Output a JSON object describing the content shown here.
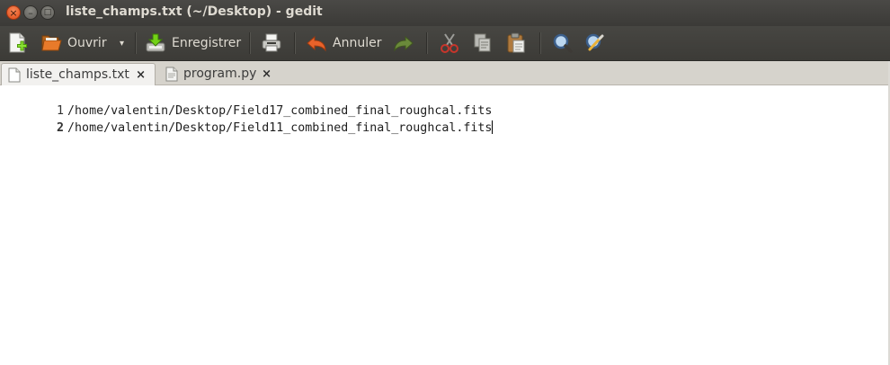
{
  "window": {
    "title": "liste_champs.txt (~/Desktop) - gedit",
    "controls": {
      "close": "×",
      "minimize": "–",
      "maximize": "□"
    }
  },
  "toolbar": {
    "new_icon": "new-document-icon",
    "open_label": "Ouvrir",
    "open_dropdown": "▾",
    "save_label": "Enregistrer",
    "print_icon": "printer-icon",
    "undo_label": "Annuler",
    "redo_icon": "redo-arrow-icon",
    "cut_icon": "scissors-icon",
    "copy_icon": "copy-icon",
    "paste_icon": "clipboard-icon",
    "find_icon": "magnifier-icon",
    "replace_icon": "find-replace-icon"
  },
  "tabs": [
    {
      "label": "liste_champs.txt",
      "close": "×",
      "active": true
    },
    {
      "label": "program.py",
      "close": "×",
      "active": false
    }
  ],
  "editor": {
    "lines": [
      {
        "number": "1",
        "text": "/home/valentin/Desktop/Field17_combined_final_roughcal.fits"
      },
      {
        "number": "2",
        "text": "/home/valentin/Desktop/Field11_combined_final_roughcal.fits"
      }
    ],
    "current_line": 2
  },
  "colors": {
    "titlebar_bg": "#3c3b37",
    "close_button": "#e9541f",
    "toolbar_text": "#dfdbd2",
    "editor_bg": "#ffffff"
  }
}
